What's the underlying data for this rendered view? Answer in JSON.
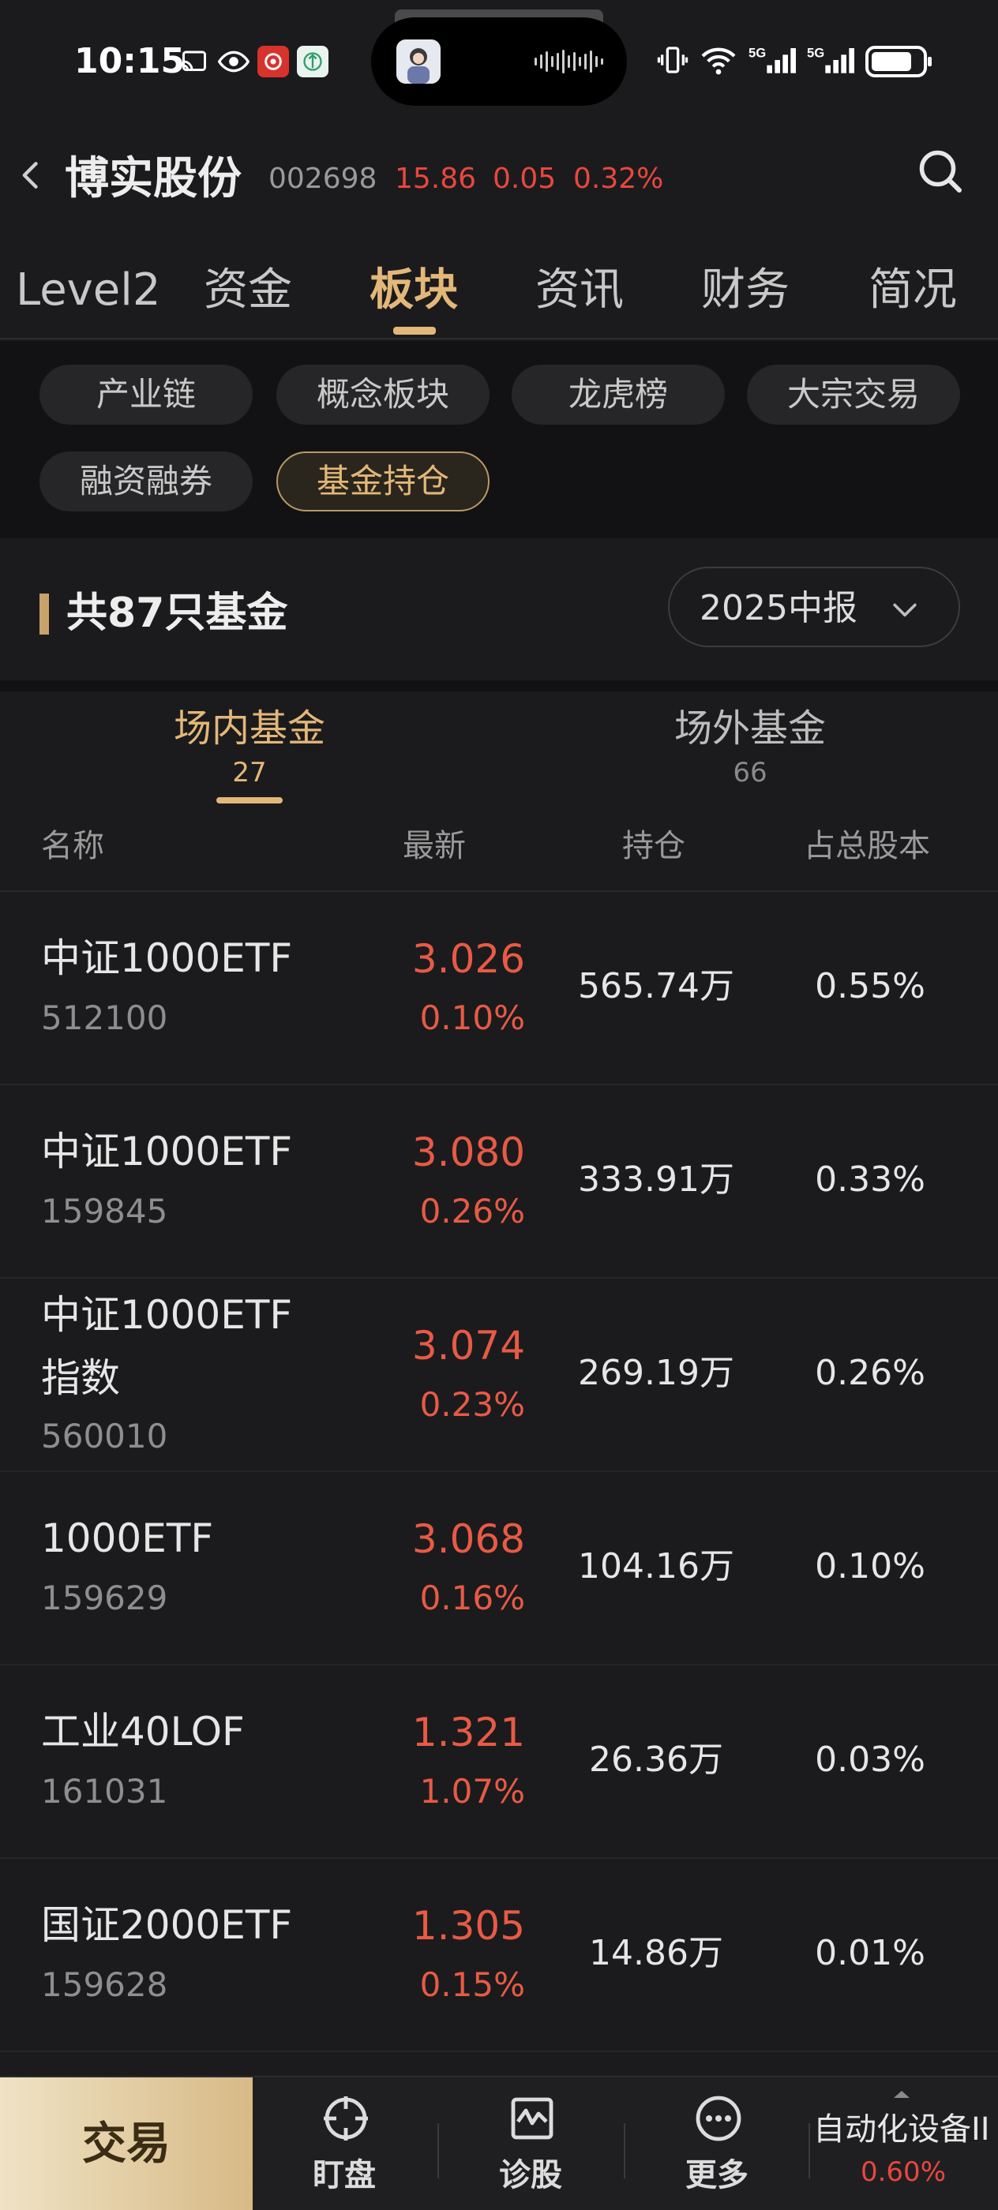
{
  "status_bar": {
    "time": "10:15",
    "left_icons": [
      "cast-icon",
      "eye-icon",
      "app-red-icon",
      "app-green-icon"
    ],
    "right_icons": [
      "vibrate-icon",
      "wifi-icon",
      "signal-5g-icon",
      "signal-5g-icon",
      "battery-icon"
    ],
    "battery_level": 0.8
  },
  "header": {
    "name": "博实股份",
    "code": "002698",
    "price": "15.86",
    "change": "0.05",
    "change_pct": "0.32%",
    "up_color": "#e9473f"
  },
  "tabs": [
    {
      "label": "Level2",
      "active": false
    },
    {
      "label": "资金",
      "active": false
    },
    {
      "label": "板块",
      "active": true
    },
    {
      "label": "资讯",
      "active": false
    },
    {
      "label": "财务",
      "active": false
    },
    {
      "label": "简况",
      "active": false
    }
  ],
  "chips": [
    {
      "label": "产业链",
      "active": false
    },
    {
      "label": "概念板块",
      "active": false
    },
    {
      "label": "龙虎榜",
      "active": false
    },
    {
      "label": "大宗交易",
      "active": false
    },
    {
      "label": "融资融券",
      "active": false
    },
    {
      "label": "基金持仓",
      "active": true
    }
  ],
  "section": {
    "title": "共87只基金",
    "period": "2025中报"
  },
  "fund_tabs": [
    {
      "label": "场内基金",
      "count": "27",
      "active": true
    },
    {
      "label": "场外基金",
      "count": "66",
      "active": false
    }
  ],
  "columns": {
    "name": "名称",
    "latest": "最新",
    "holding": "持仓",
    "ratio": "占总股本"
  },
  "funds": [
    {
      "name": "中证1000ETF",
      "code": "512100",
      "price": "3.026",
      "pct": "0.10%",
      "holding": "565.74万",
      "ratio": "0.55%"
    },
    {
      "name": "中证1000ETF",
      "code": "159845",
      "price": "3.080",
      "pct": "0.26%",
      "holding": "333.91万",
      "ratio": "0.33%"
    },
    {
      "name": "中证1000ETF指数",
      "code": "560010",
      "price": "3.074",
      "pct": "0.23%",
      "holding": "269.19万",
      "ratio": "0.26%"
    },
    {
      "name": "1000ETF",
      "code": "159629",
      "price": "3.068",
      "pct": "0.16%",
      "holding": "104.16万",
      "ratio": "0.10%"
    },
    {
      "name": "工业40LOF",
      "code": "161031",
      "price": "1.321",
      "pct": "1.07%",
      "holding": "26.36万",
      "ratio": "0.03%"
    },
    {
      "name": "国证2000ETF",
      "code": "159628",
      "price": "1.305",
      "pct": "0.15%",
      "holding": "14.86万",
      "ratio": "0.01%"
    }
  ],
  "bottom_bar": {
    "trade": "交易",
    "items": [
      {
        "label": "盯盘",
        "icon": "crosshair-icon"
      },
      {
        "label": "诊股",
        "icon": "pulse-chart-icon"
      },
      {
        "label": "更多",
        "icon": "more-dots-icon"
      }
    ],
    "sector_name": "自动化设备II",
    "sector_pct": "0.60%"
  }
}
